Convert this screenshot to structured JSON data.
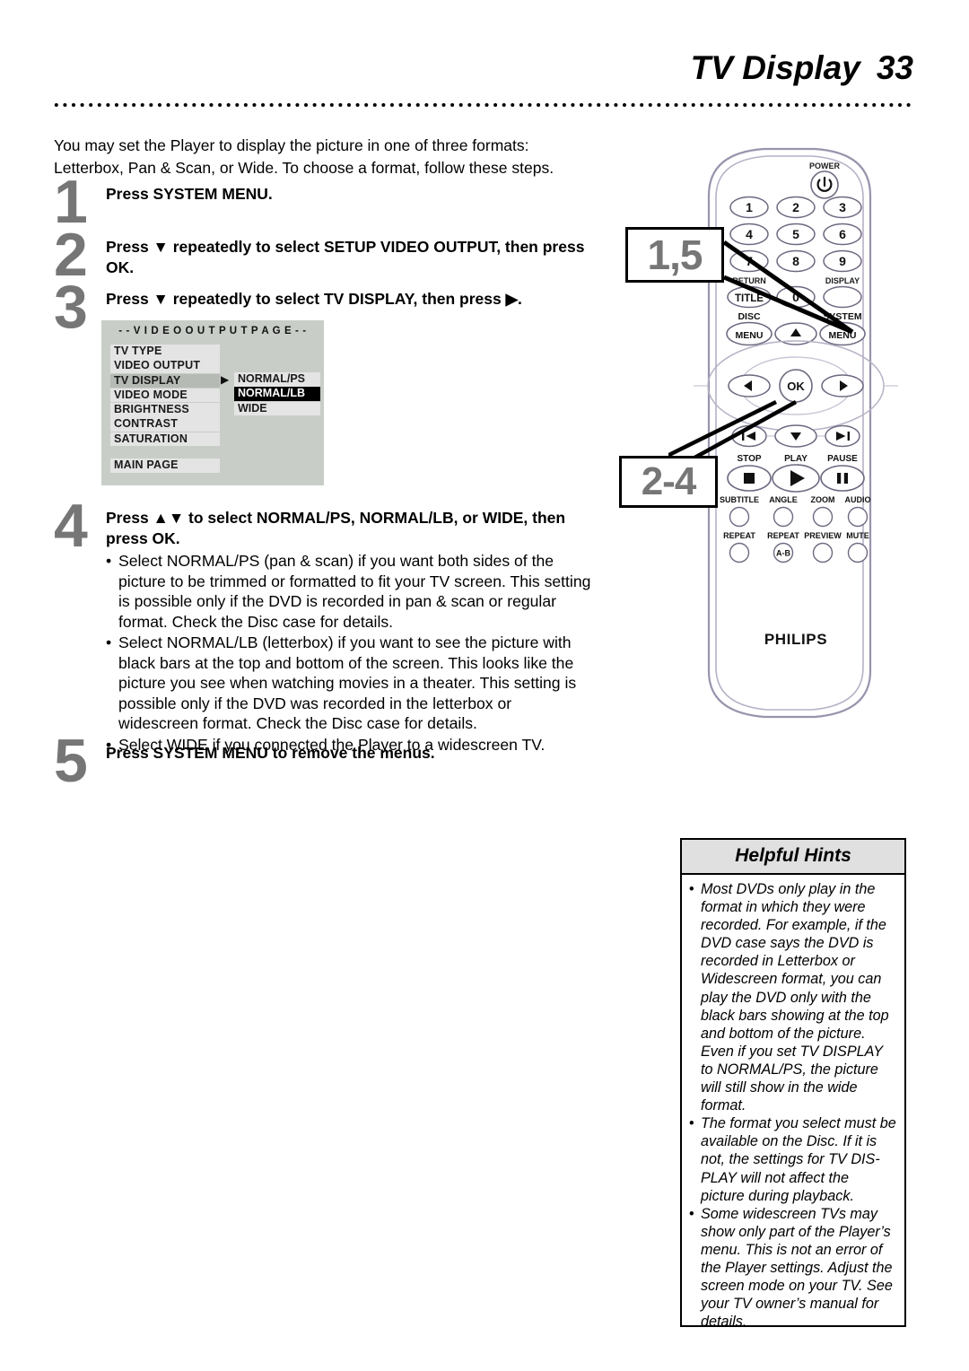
{
  "header": {
    "title": "TV Display",
    "page_number": "33"
  },
  "intro": "You may set the Player to display the picture in one of three formats: Letterbox, Pan & Scan, or Wide. To choose a format, follow these steps.",
  "steps": [
    {
      "num": "1",
      "head": "Press SYSTEM MENU."
    },
    {
      "num": "2",
      "head": "Press ▼ repeatedly to select SETUP VIDEO OUTPUT, then press OK."
    },
    {
      "num": "3",
      "head": "Press ▼ repeatedly to select TV DISPLAY, then press ▶."
    },
    {
      "num": "4",
      "head": "Press ▲▼ to select NORMAL/PS, NORMAL/LB, or WIDE, then press OK.",
      "bullets": [
        "Select NORMAL/PS (pan & scan) if you want both sides of the picture to be trimmed or formatted to fit your TV screen. This setting is possible only if the DVD is recorded in pan & scan or regular format. Check the Disc case for details.",
        "Select NORMAL/LB (letterbox) if you want to see the picture with black bars at the top and bottom of the screen. This looks like the picture you see when watching movies in a theater. This setting is possible only if the DVD was recorded in the letterbox or widescreen format. Check the Disc case for details.",
        "Select WIDE if you connected the Player to a widescreen TV."
      ]
    },
    {
      "num": "5",
      "head": "Press SYSTEM MENU to remove the menus."
    }
  ],
  "osd": {
    "title": "- -  V I D E O  O U T P U T  P A G E  - -",
    "items": [
      {
        "label": "TV TYPE",
        "selected": false
      },
      {
        "label": "VIDEO OUTPUT",
        "selected": false
      },
      {
        "label": "TV DISPLAY",
        "selected": true
      },
      {
        "label": "VIDEO MODE",
        "selected": false
      },
      {
        "label": "BRIGHTNESS",
        "selected": false
      },
      {
        "label": "CONTRAST",
        "selected": false
      },
      {
        "label": "SATURATION",
        "selected": false
      }
    ],
    "main_page": "MAIN PAGE",
    "arrow": "▶",
    "options": [
      {
        "label": "NORMAL/PS",
        "highlighted": false
      },
      {
        "label": "NORMAL/LB",
        "highlighted": true
      },
      {
        "label": "WIDE",
        "highlighted": false
      }
    ]
  },
  "callouts": {
    "top": "1,5",
    "bottom": "2-4"
  },
  "remote": {
    "brand": "PHILIPS",
    "power_label": "POWER",
    "keypad": [
      "1",
      "2",
      "3",
      "4",
      "5",
      "6",
      "7",
      "8",
      "9",
      "0"
    ],
    "title_label": "TITLE",
    "return_label": "RETURN",
    "display_label": "DISPLAY",
    "disc_label": "DISC",
    "disc_menu": "MENU",
    "system_label": "SYSTEM",
    "system_menu": "MENU",
    "ok_label": "OK",
    "up_arrow": "▲",
    "down_arrow": "▼",
    "left_arrow": "◀",
    "right_arrow": "▶",
    "stop_label": "STOP",
    "play_label": "PLAY",
    "pause_label": "PAUSE",
    "feature_row_1": [
      "SUBTITLE",
      "ANGLE",
      "ZOOM",
      "AUDIO"
    ],
    "feature_row_2": [
      "REPEAT",
      "REPEAT",
      "PREVIEW",
      "MUTE"
    ],
    "repeat_ab": "A-B"
  },
  "hints": {
    "title": "Helpful Hints",
    "items": [
      "Most DVDs only play in the format in which they were recorded. For example, if the DVD case says the DVD is recorded in Letterbox or Widescreen format, you can play the DVD only with the black bars showing at the top and bottom of the picture. Even if you set TV DISPLAY to NORMAL/PS, the picture will still show in the wide format.",
      "The format you select must be available on the Disc. If it is not, the settings for TV DIS-PLAY will not affect the picture during playback.",
      "Some widescreen TVs may show only part of the Player’s menu. This is not an error of the Player settings. Adjust the screen mode on your TV. See your TV owner’s manual for details."
    ]
  }
}
